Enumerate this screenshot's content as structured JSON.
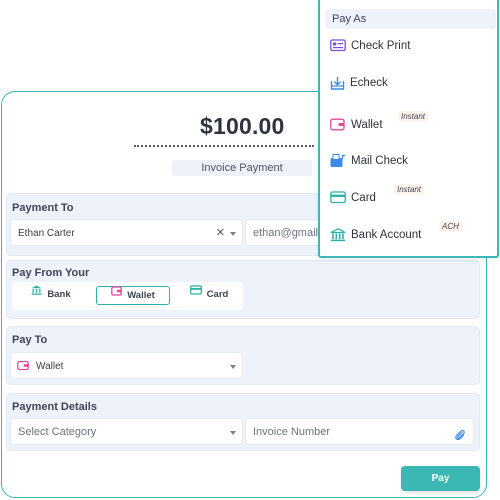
{
  "invoice": {
    "amount": "$100.00",
    "subtitle": "Invoice Payment"
  },
  "payment_to": {
    "label": "Payment To",
    "recipient": "Ethan Carter",
    "email": "ethan@gmail.c"
  },
  "pay_from": {
    "label": "Pay From Your",
    "options": [
      {
        "label": "Bank",
        "icon": "bank-icon",
        "selected": false
      },
      {
        "label": "Wallet",
        "icon": "wallet-icon",
        "selected": true
      },
      {
        "label": "Card",
        "icon": "card-icon",
        "selected": false
      }
    ]
  },
  "pay_to": {
    "label": "Pay To",
    "value": "Wallet"
  },
  "payment_details": {
    "label": "Payment Details",
    "category_placeholder": "Select Category",
    "invoice_number_placeholder": "Invoice Number"
  },
  "pay_button": "Pay",
  "pay_as_menu": {
    "header": "Pay As",
    "items": [
      {
        "label": "Check Print",
        "icon": "check-print-icon",
        "tag": ""
      },
      {
        "label": "Echeck",
        "icon": "echeck-icon",
        "tag": ""
      },
      {
        "label": "Wallet",
        "icon": "wallet-icon",
        "tag": "Instant"
      },
      {
        "label": "Mail Check",
        "icon": "mail-check-icon",
        "tag": ""
      },
      {
        "label": "Card",
        "icon": "card-icon",
        "tag": "Instant"
      },
      {
        "label": "Bank Account",
        "icon": "bank-icon",
        "tag": "ACH"
      }
    ]
  },
  "colors": {
    "accent": "#3bb8b3",
    "section_bg": "#eef3fb",
    "wallet_pink": "#e0489a",
    "check_purple": "#7a4fe0",
    "mail_blue": "#3d8be8",
    "card_teal": "#2fb1a9"
  }
}
